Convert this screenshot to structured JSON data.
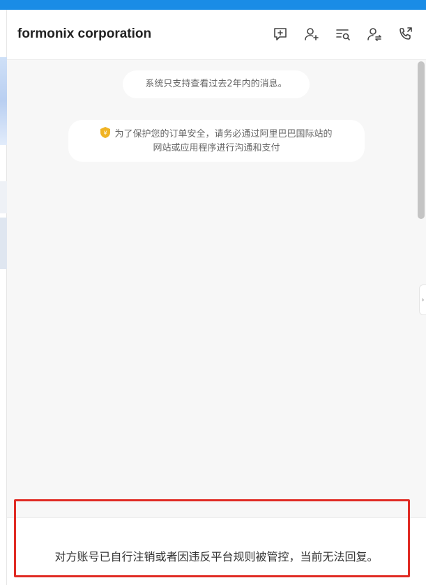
{
  "header": {
    "title": "formonix corporation",
    "icons": [
      "add-message-icon",
      "add-contact-icon",
      "search-messages-icon",
      "transfer-contact-icon",
      "phone-call-icon"
    ]
  },
  "chat": {
    "notice": "系统只支持查看过去2年内的消息。",
    "safety_line1": "为了保护您的订单安全，请务必通过阿里巴巴国际站的",
    "safety_line2": "网站或应用程序进行沟通和支付"
  },
  "footer": {
    "message": "对方账号已自行注销或者因违反平台规则被管控，当前无法回复。"
  },
  "side_toggle": "›",
  "colors": {
    "top_strip": "#1a8ce6",
    "highlight_box": "#e02b24",
    "shield_gold": "#f0b323"
  }
}
